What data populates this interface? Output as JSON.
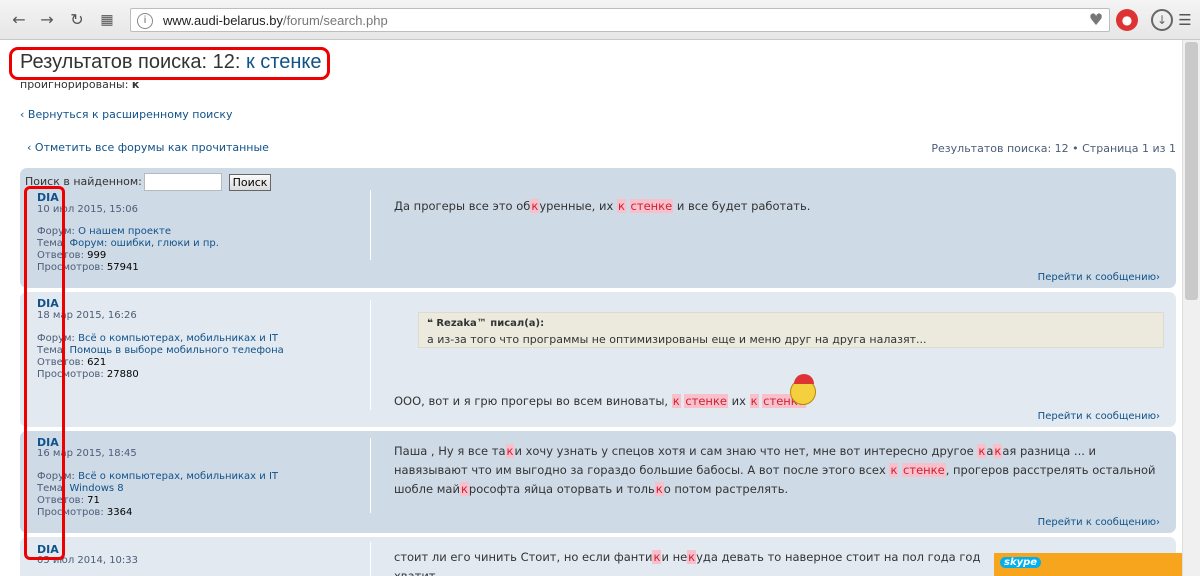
{
  "browser": {
    "url_host": "www.audi-belarus.by",
    "url_path": "/forum/search.php"
  },
  "page": {
    "title_prefix": "Результатов поиска: 12: ",
    "title_query": "к стенке",
    "ignored_label": "проигнорированы: ",
    "ignored_value": "к",
    "back_link": "Вернуться к расширенному поиску",
    "mark_read": "Отметить все форумы как прочитанные",
    "pager": "Результатов поиска: 12 • Страница 1 из 1",
    "search_label": "Поиск в найденном:",
    "search_value": "",
    "search_button": "Поиск",
    "goto_label": "Перейти к сообщению"
  },
  "labels": {
    "forum": "Форум: ",
    "topic": "Тема: ",
    "replies": "Ответов: ",
    "views": "Просмотров: "
  },
  "posts": [
    {
      "author": "DIA",
      "date": "10 июл 2015, 15:06",
      "forum": "О нашем проекте",
      "topic": "Форум: ошибки, глюки и пр.",
      "replies": "999",
      "views": "57941",
      "content": [
        [
          "Да прогеры все это об",
          false
        ],
        [
          "к",
          true
        ],
        [
          "уренные, их ",
          false
        ],
        [
          "к",
          true
        ],
        [
          " ",
          false
        ],
        [
          "стенке",
          true
        ],
        [
          " и все будет работать.",
          false
        ]
      ]
    },
    {
      "author": "DIA",
      "date": "18 мар 2015, 16:26",
      "forum": "Всё о компьютерах, мобильниках и IT",
      "topic": "Помощь в выборе мобильного телефона",
      "replies": "621",
      "views": "27880",
      "quote_author": "Rezaka™ писал(а):",
      "quote_text": "а из-за того что программы не оптимизированы еще и меню друг на друга налазят...",
      "content": [
        [
          "ООО, вот и я грю прогеры во всем виноваты, ",
          false
        ],
        [
          "к",
          true
        ],
        [
          " ",
          false
        ],
        [
          "стенке",
          true
        ],
        [
          " их ",
          false
        ],
        [
          "к",
          true
        ],
        [
          " ",
          false
        ],
        [
          "стенке",
          true
        ]
      ]
    },
    {
      "author": "DIA",
      "date": "16 мар 2015, 18:45",
      "forum": "Всё о компьютерах, мобильниках и IT",
      "topic": "Windows 8",
      "replies": "71",
      "views": "3364",
      "content": [
        [
          "Паша , Ну я все та",
          false
        ],
        [
          "к",
          true
        ],
        [
          "и хочу узнать у спецов хотя и сам знаю что нет, мне вот интересно другое ",
          false
        ],
        [
          "к",
          true
        ],
        [
          "а",
          false
        ],
        [
          "к",
          true
        ],
        [
          "ая разница ... и навязывают что им выгодно за гораздо большие бабосы. А вот после этого всех ",
          false
        ],
        [
          "к",
          true
        ],
        [
          " ",
          false
        ],
        [
          "стенке",
          true
        ],
        [
          ", прогеров расстрелять остальной шобле май",
          false
        ],
        [
          "к",
          true
        ],
        [
          "рософта яйца оторвать и толь",
          false
        ],
        [
          "к",
          true
        ],
        [
          "о потом растрелять.",
          false
        ]
      ]
    },
    {
      "author": "DIA",
      "date": "05 июл 2014, 10:33",
      "content": [
        [
          "стоит ли его чинить Стоит, но если фанти",
          false
        ],
        [
          "к",
          true
        ],
        [
          "и не",
          false
        ],
        [
          "к",
          true
        ],
        [
          "уда девать то наверное стоит на пол года год хватит.",
          false
        ]
      ]
    }
  ],
  "skype_label": "skype"
}
